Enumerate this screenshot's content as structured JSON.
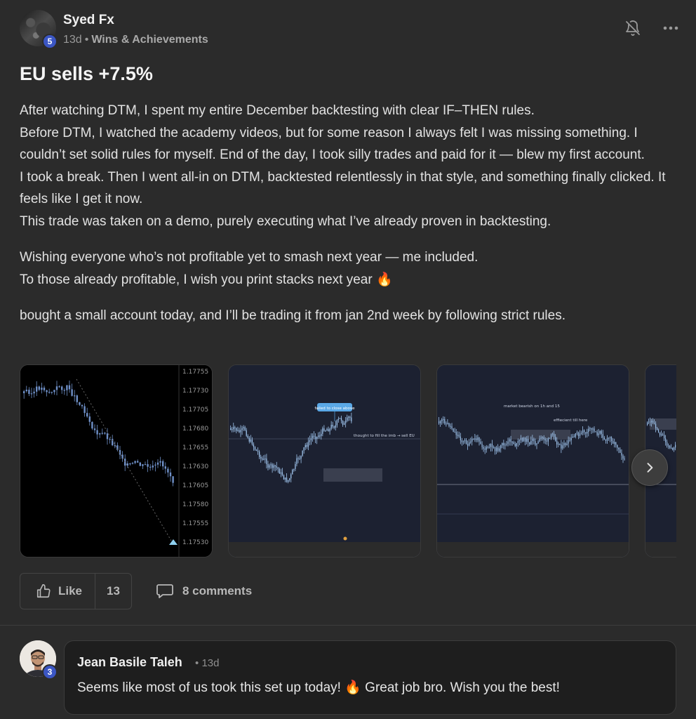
{
  "post": {
    "author": "Syed Fx",
    "level": "5",
    "age": "13d",
    "separator": "•",
    "category": "Wins & Achievements",
    "title": "EU sells +7.5%",
    "paragraphs": [
      "After watching DTM, I spent my entire December backtesting with clear IF–THEN rules.",
      "Before DTM, I watched the academy videos, but for some reason I always felt I was missing something. I couldn’t set solid rules for myself. End of the day, I took silly trades and paid for it — blew my first account.",
      "I took a break. Then I went all-in on DTM, backtested relentlessly in that style, and something finally clicked. It feels like I get it now.",
      "This trade was taken on a demo, purely executing what I’ve already proven in backtesting.",
      "Wishing everyone who’s not profitable yet to smash next year — me included.",
      "To those already profitable, I wish you print stacks next year 🔥",
      "bought a small account today, and I’ll be trading it from jan 2nd week by following strict rules."
    ],
    "images": {
      "chart1_price_ticks": [
        "1.17755",
        "1.17730",
        "1.17705",
        "1.17680",
        "1.17655",
        "1.17630",
        "1.17605",
        "1.17580",
        "1.17555",
        "1.17530"
      ],
      "chart2_callout": "failed to close above",
      "chart2_note": "thought to fill the imb → sell EU",
      "chart3_note_top": "market bearish on 1h and 15",
      "chart3_note_mid": "effiecient till here"
    }
  },
  "actions": {
    "like_label": "Like",
    "like_count": "13",
    "comments_label": "8 comments"
  },
  "comment": {
    "author": "Jean Basile Taleh",
    "level": "3",
    "age": "13d",
    "separator": "•",
    "text": "Seems like most of us took this set up today! 🔥 Great job bro. Wish you the best!"
  },
  "icons": {
    "bell": "bell-off-icon",
    "more": "more-horizontal-icon",
    "like": "thumbs-up-icon",
    "comment": "comment-icon",
    "next": "chevron-right-icon"
  },
  "colors": {
    "background": "#2b2b2b",
    "badge": "#3b56c4",
    "chart_bg": "#1c2131",
    "candle": "#8fb3e0"
  }
}
